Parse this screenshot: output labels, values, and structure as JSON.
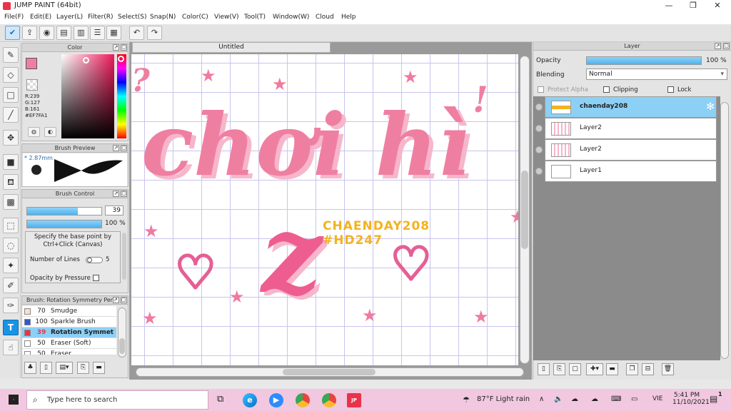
{
  "window": {
    "title": "JUMP PAINT (64bit)",
    "minimize": "—",
    "maximize": "❐",
    "close": "✕"
  },
  "menu": [
    "File(F)",
    "Edit(E)",
    "Layer(L)",
    "Filter(R)",
    "Select(S)",
    "Snap(N)",
    "Color(C)",
    "View(V)",
    "Tool(T)",
    "Window(W)",
    "Cloud",
    "Help"
  ],
  "color_panel": {
    "title": "Color",
    "r": "R:239",
    "g": "G:127",
    "b": "B:161",
    "hex": "#EF7FA1",
    "current_color": "#EF7FA1"
  },
  "brush_preview": {
    "title": "Brush Preview",
    "size": "* 2.87mm"
  },
  "brush_control": {
    "title": "Brush Control",
    "size_value": "39",
    "size_fraction": 0.68,
    "opacity_value": "100",
    "opacity_unit": "%",
    "opacity_fraction": 1.0,
    "hint": "Specify the base point by Ctrl+Click (Canvas)",
    "lines_label": "Number of Lines",
    "lines_value": "5",
    "pressure_label": "Opacity by Pressure"
  },
  "brush_list": {
    "title": "Brush: Rotation Symmetry Pen",
    "items": [
      {
        "size": "70",
        "name": "Smudge",
        "color": "#fbe0c8"
      },
      {
        "size": "100",
        "name": "Sparkle Brush",
        "color": "#2d5ad0"
      },
      {
        "size": "39",
        "name": "Rotation Symmet",
        "color": "#e8334a"
      },
      {
        "size": "50",
        "name": "Eraser (Soft)",
        "color": "#ffffff"
      },
      {
        "size": "50",
        "name": "Eraser",
        "color": "#ffffff"
      }
    ]
  },
  "document": {
    "tab": "Untitled",
    "lettering_line1": "chơi hì",
    "lettering_line2": "z",
    "watermark_line1": "CHAENDAY208",
    "watermark_line2": "#HD247",
    "exclaim": "!",
    "exclaim_left": "?"
  },
  "layer_panel": {
    "title": "Layer",
    "opacity_label": "Opacity",
    "opacity_value": "100",
    "opacity_unit": "%",
    "opacity_fraction": 1.0,
    "blending_label": "Blending",
    "blending_value": "Normal",
    "protect_alpha": "Protect Alpha",
    "clipping": "Clipping",
    "lock": "Lock",
    "layers": [
      {
        "name": "chaenday208",
        "selected": true
      },
      {
        "name": "Layer2",
        "selected": false
      },
      {
        "name": "Layer2",
        "selected": false
      },
      {
        "name": "Layer1",
        "selected": false
      }
    ]
  },
  "taskbar": {
    "search_placeholder": "Type here to search",
    "weather": "87°F  Light rain",
    "lang": "VIE",
    "time": "5:41 PM",
    "date": "11/10/2021",
    "notifications": "1"
  }
}
